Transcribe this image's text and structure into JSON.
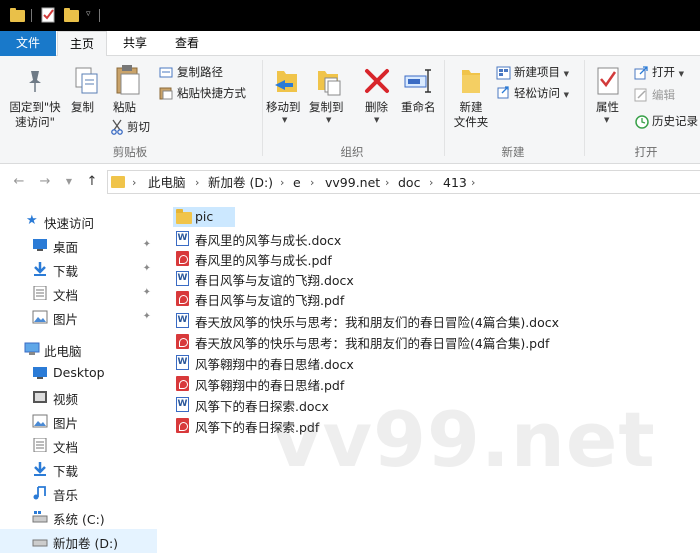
{
  "window": {
    "quick_access": [
      "folder-icon",
      "checkmark-properties-icon",
      "folder-icon",
      "dropdown-icon"
    ]
  },
  "ribbon_tabs": [
    {
      "label": "文件"
    },
    {
      "label": "主页"
    },
    {
      "label": "共享"
    },
    {
      "label": "查看"
    }
  ],
  "ribbon": {
    "clipboard": {
      "pin_label_1": "固定到\"快",
      "pin_label_2": "速访问\"",
      "copy": "复制",
      "paste": "粘贴",
      "copy_path": "复制路径",
      "paste_shortcut": "粘贴快捷方式",
      "cut": "剪切",
      "group": "剪贴板"
    },
    "organize": {
      "move_to": "移动到",
      "copy_to": "复制到",
      "delete": "删除",
      "rename": "重命名",
      "group": "组织"
    },
    "new": {
      "new_folder_1": "新建",
      "new_folder_2": "文件夹",
      "new_item": "新建项目",
      "easy_access": "轻松访问",
      "group": "新建"
    },
    "open": {
      "properties": "属性",
      "open": "打开",
      "edit": "编辑",
      "history": "历史记录",
      "group": "打开"
    }
  },
  "address": {
    "crumbs": [
      "此电脑",
      "新加卷 (D:)",
      "e",
      "vv99.net",
      "doc",
      "413"
    ]
  },
  "nav": {
    "quick_access": "快速访问",
    "quick_items": [
      {
        "label": "桌面",
        "icon": "desktop-icon"
      },
      {
        "label": "下载",
        "icon": "download-icon"
      },
      {
        "label": "文档",
        "icon": "documents-icon"
      },
      {
        "label": "图片",
        "icon": "pictures-icon"
      }
    ],
    "this_pc": "此电脑",
    "pc_items": [
      {
        "label": "Desktop",
        "icon": "desktop-icon"
      },
      {
        "label": "视频",
        "icon": "video-icon"
      },
      {
        "label": "图片",
        "icon": "pictures-icon"
      },
      {
        "label": "文档",
        "icon": "documents-icon"
      },
      {
        "label": "下载",
        "icon": "download-icon"
      },
      {
        "label": "音乐",
        "icon": "music-icon"
      },
      {
        "label": "系统 (C:)",
        "icon": "drive-icon"
      },
      {
        "label": "新加卷 (D:)",
        "icon": "drive-icon"
      }
    ]
  },
  "files": [
    {
      "name": "pic",
      "type": "folder"
    },
    {
      "name": "春风里的风筝与成长.docx",
      "type": "docx"
    },
    {
      "name": "春风里的风筝与成长.pdf",
      "type": "pdf"
    },
    {
      "name": "春日风筝与友谊的飞翔.docx",
      "type": "docx"
    },
    {
      "name": "春日风筝与友谊的飞翔.pdf",
      "type": "pdf"
    },
    {
      "name": "春天放风筝的快乐与思考：我和朋友们的春日冒险(4篇合集).docx",
      "type": "docx"
    },
    {
      "name": "春天放风筝的快乐与思考：我和朋友们的春日冒险(4篇合集).pdf",
      "type": "pdf"
    },
    {
      "name": "风筝翱翔中的春日思绪.docx",
      "type": "docx"
    },
    {
      "name": "风筝翱翔中的春日思绪.pdf",
      "type": "pdf"
    },
    {
      "name": "风筝下的春日探索.docx",
      "type": "docx"
    },
    {
      "name": "风筝下的春日探索.pdf",
      "type": "pdf"
    }
  ],
  "watermark": "vv99.net",
  "colors": {
    "file_tab": "#1979ca",
    "selection": "#cce8ff",
    "titlebar": "#000000"
  }
}
